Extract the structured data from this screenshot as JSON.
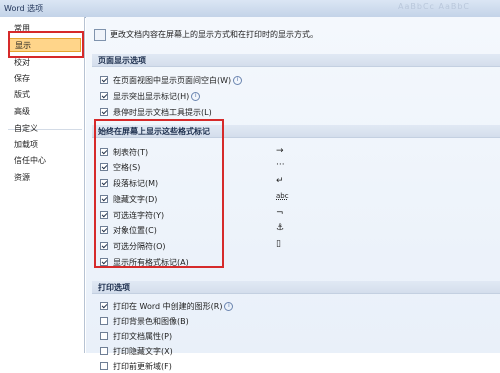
{
  "window": {
    "title": "Word 选项",
    "deco": "AaBbCc  AaBbC"
  },
  "sidebar": {
    "items": [
      {
        "label": "常用"
      },
      {
        "label": "显示",
        "selected": true
      },
      {
        "label": "校对"
      },
      {
        "label": "保存"
      },
      {
        "label": "版式"
      },
      {
        "label": "高级"
      },
      {
        "label": "自定义"
      },
      {
        "label": "加载项"
      },
      {
        "label": "信任中心"
      },
      {
        "label": "资源"
      }
    ]
  },
  "main": {
    "intro": "更改文档内容在屏幕上的显示方式和在打印时的显示方式。",
    "page_display": {
      "title": "页面显示选项",
      "items": [
        {
          "label": "在页面视图中显示页面间空白(W)",
          "checked": true,
          "info": "i"
        },
        {
          "label": "显示突出显示标记(H)",
          "checked": true,
          "info": "i"
        },
        {
          "label": "悬停时显示文档工具提示(L)",
          "checked": true
        }
      ]
    },
    "formatting_marks": {
      "title": "始终在屏幕上显示这些格式标记",
      "items": [
        {
          "label": "制表符(T)",
          "checked": true,
          "symbol": "→"
        },
        {
          "label": "空格(S)",
          "checked": true,
          "symbol": "···"
        },
        {
          "label": "段落标记(M)",
          "checked": true,
          "symbol": "↵"
        },
        {
          "label": "隐藏文字(D)",
          "checked": true,
          "symbol": "abc"
        },
        {
          "label": "可选连字符(Y)",
          "checked": true,
          "symbol": "¬"
        },
        {
          "label": "对象位置(C)",
          "checked": true,
          "symbol": "⚓"
        },
        {
          "label": "可选分隔符(O)",
          "checked": true,
          "symbol": "▯"
        },
        {
          "label": "显示所有格式标记(A)",
          "checked": true
        }
      ]
    },
    "print": {
      "title": "打印选项",
      "items": [
        {
          "label": "打印在 Word 中创建的图形(R)",
          "checked": true,
          "info": "i"
        },
        {
          "label": "打印背景色和图像(B)",
          "checked": false
        },
        {
          "label": "打印文档属性(P)",
          "checked": false
        },
        {
          "label": "打印隐藏文字(X)",
          "checked": false
        },
        {
          "label": "打印前更新域(F)",
          "checked": false
        }
      ]
    }
  },
  "colors": {
    "highlight": "#d62a2a",
    "selected_nav": "#ffd58a"
  }
}
